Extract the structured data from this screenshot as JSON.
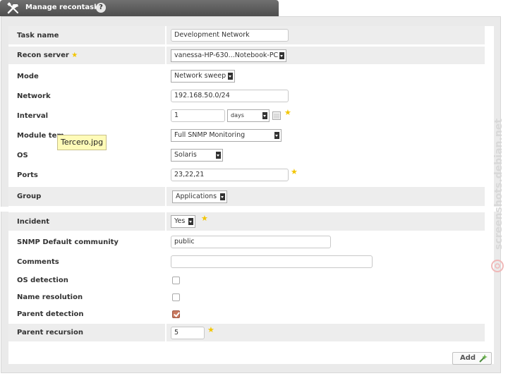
{
  "header": {
    "title": "Manage recontask",
    "help_glyph": "?"
  },
  "form": {
    "task_name": {
      "label": "Task name",
      "value": "Development Network"
    },
    "recon_server": {
      "label": "Recon server",
      "value": "vanessa-HP-630...Notebook-PC"
    },
    "mode": {
      "label": "Mode",
      "value": "Network sweep"
    },
    "network": {
      "label": "Network",
      "value": "192.168.50.0/24"
    },
    "interval": {
      "label": "Interval",
      "value": "1",
      "unit": "days"
    },
    "module_template": {
      "label": "Module tem",
      "value": "Full SNMP Monitoring"
    },
    "os": {
      "label": "OS",
      "value": "Solaris"
    },
    "ports": {
      "label": "Ports",
      "value": "23,22,21"
    },
    "group": {
      "label": "Group",
      "value": "Applications"
    },
    "incident": {
      "label": "Incident",
      "value": "Yes"
    },
    "snmp_community": {
      "label": "SNMP Default community",
      "value": "public"
    },
    "comments": {
      "label": "Comments",
      "value": ""
    },
    "os_detection": {
      "label": "OS detection",
      "checked": false
    },
    "name_resolution": {
      "label": "Name resolution",
      "checked": false
    },
    "parent_detection": {
      "label": "Parent detection",
      "checked": true
    },
    "parent_recursion": {
      "label": "Parent recursion",
      "value": "5"
    }
  },
  "tooltip": {
    "text": "Tercero.jpg"
  },
  "actions": {
    "add_label": "Add"
  },
  "watermark": {
    "text": "screenshots.debian.net"
  },
  "colors": {
    "header_bg": "#5c5c5c",
    "star": "#f2c500",
    "row_shade": "#ededed",
    "check_on": "#c97a60"
  }
}
